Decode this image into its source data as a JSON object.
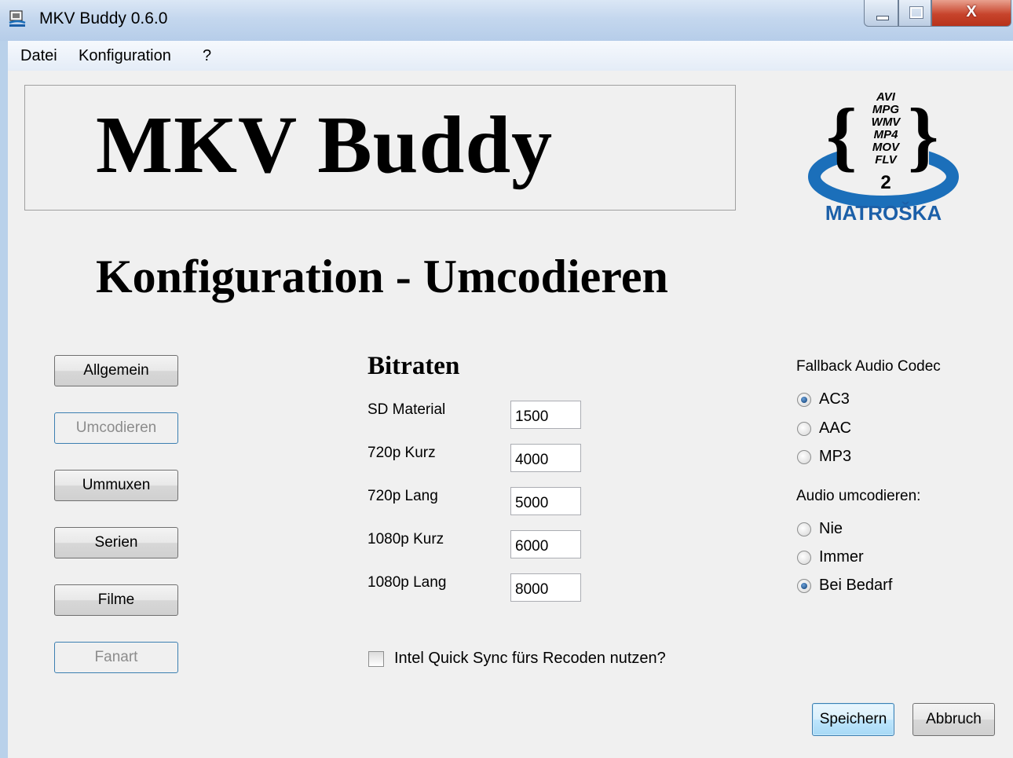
{
  "window": {
    "title": "MKV Buddy 0.6.0",
    "icon": "app-icon",
    "controls": {
      "close_glyph": "X"
    }
  },
  "menu": [
    "Datei",
    "Konfiguration",
    "?"
  ],
  "banner": {
    "title": "MKV Buddy"
  },
  "logo": {
    "formats": [
      "AVI",
      "MPG",
      "WMV",
      "MP4",
      "MOV",
      "FLV"
    ],
    "number": "2",
    "brand": "MATROŠKA",
    "colors": {
      "ring": "#1b6fba",
      "brand": "#1b5fa8"
    }
  },
  "page_title": "Konfiguration - Umcodieren",
  "nav": [
    {
      "label": "Allgemein",
      "enabled": true
    },
    {
      "label": "Umcodieren",
      "enabled": false
    },
    {
      "label": "Ummuxen",
      "enabled": true
    },
    {
      "label": "Serien",
      "enabled": true
    },
    {
      "label": "Filme",
      "enabled": true
    },
    {
      "label": "Fanart",
      "enabled": false
    }
  ],
  "bitrates": {
    "heading": "Bitraten",
    "fields": [
      {
        "label": "SD Material",
        "value": "1500"
      },
      {
        "label": "720p Kurz",
        "value": "4000"
      },
      {
        "label": "720p Lang",
        "value": "5000"
      },
      {
        "label": "1080p Kurz",
        "value": "6000"
      },
      {
        "label": "1080p Lang",
        "value": "8000"
      }
    ]
  },
  "quicksync": {
    "label": "Intel Quick Sync fürs Recoden nutzen?",
    "checked": false
  },
  "fallback_codec": {
    "label": "Fallback Audio Codec",
    "options": [
      {
        "label": "AC3",
        "checked": true
      },
      {
        "label": "AAC",
        "checked": false
      },
      {
        "label": "MP3",
        "checked": false
      }
    ]
  },
  "audio_transcode": {
    "label": "Audio umcodieren:",
    "options": [
      {
        "label": "Nie",
        "checked": false
      },
      {
        "label": "Immer",
        "checked": false
      },
      {
        "label": "Bei Bedarf",
        "checked": true
      }
    ]
  },
  "actions": {
    "save": "Speichern",
    "cancel": "Abbruch"
  }
}
